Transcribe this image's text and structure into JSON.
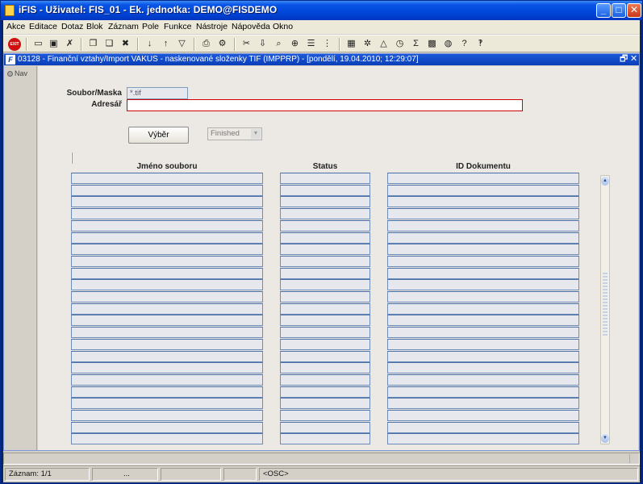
{
  "window": {
    "title": "iFIS - Uživatel: FIS_01 - Ek. jednotka: DEMO@FISDEMO",
    "minimize_glyph": "_",
    "maximize_glyph": "□",
    "close_glyph": "✕"
  },
  "menu": [
    "Akce",
    "Editace",
    "Dotaz",
    "Blok",
    "Záznam",
    "Pole",
    "Funkce",
    "Nástroje",
    "Nápověda",
    "Okno"
  ],
  "toolbar": {
    "exit_label": "EXIT",
    "icons": [
      "save-icon",
      "lock-icon",
      "clear-record-icon",
      "copy-icon",
      "paste-icon",
      "delete-icon",
      "sort-asc-icon",
      "sort-desc-icon",
      "filter-icon",
      "print-icon",
      "print-setup-icon",
      "cut-icon",
      "paste-alt-icon",
      "find-icon",
      "find-next-icon",
      "list-icon",
      "columns-icon",
      "calculator-icon",
      "settings-icon",
      "warning-icon",
      "clock-icon",
      "sum-icon",
      "excel-icon",
      "internet-icon",
      "help-question-icon",
      "context-help-icon"
    ]
  },
  "form": {
    "title": "03128 - Finanční vztahy/Import VAKUS - naskenované složenky TIF (IMPPRP) - [pondělí, 19.04.2010; 12:29:07]",
    "restore_glyph": "🗗",
    "close_glyph": "✕",
    "nav_label": "Nav",
    "mask_label": "Soubor/Maska",
    "mask_value": "*.tif",
    "dir_label": "Adresář",
    "dir_value": "",
    "select_button": "Výběr",
    "status_combo": "Finished",
    "columns": [
      "Jméno souboru",
      "Status",
      "ID Dokumentu"
    ],
    "row_count": 23
  },
  "statusbar": {
    "record": "Záznam: 1/1",
    "dots": "...",
    "osc": "<OSC>"
  }
}
